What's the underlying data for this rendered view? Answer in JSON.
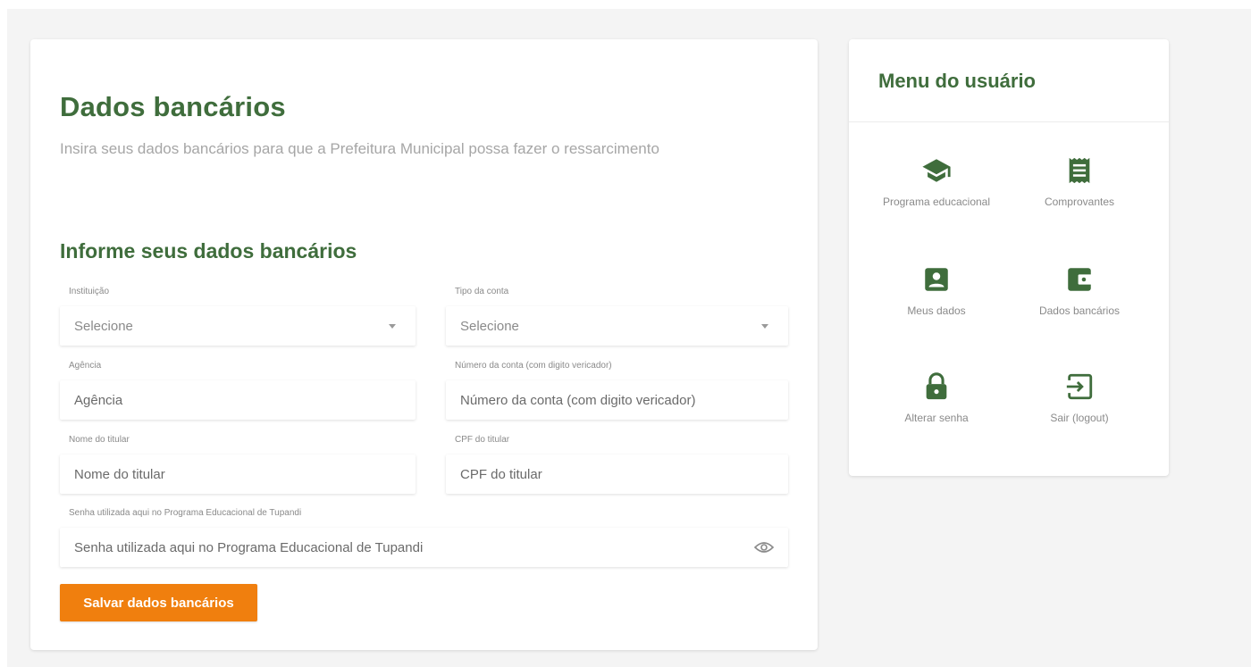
{
  "main": {
    "title": "Dados bancários",
    "subtitle": "Insira seus dados bancários para que a Prefeitura Municipal possa fazer o ressarcimento",
    "section_title": "Informe seus dados bancários",
    "fields": {
      "instituicao": {
        "label": "Instituição",
        "value": "Selecione"
      },
      "tipo_conta": {
        "label": "Tipo da conta",
        "value": "Selecione"
      },
      "agencia": {
        "label": "Agência",
        "placeholder": "Agência"
      },
      "numero_conta": {
        "label": "Número da conta (com digito vericador)",
        "placeholder": "Número da conta (com digito vericador)"
      },
      "nome_titular": {
        "label": "Nome do titular",
        "placeholder": "Nome do titular"
      },
      "cpf_titular": {
        "label": "CPF do titular",
        "placeholder": "CPF do titular"
      },
      "senha": {
        "label": "Senha utilizada aqui no Programa Educacional de Tupandi",
        "placeholder": "Senha utilizada aqui no Programa Educacional de Tupandi"
      }
    },
    "save_label": "Salvar dados bancários"
  },
  "menu": {
    "title": "Menu do usuário",
    "items": [
      {
        "label": "Programa educacional",
        "icon": "graduation-cap-icon"
      },
      {
        "label": "Comprovantes",
        "icon": "receipt-icon"
      },
      {
        "label": "Meus dados",
        "icon": "account-box-icon"
      },
      {
        "label": "Dados bancários",
        "icon": "wallet-icon"
      },
      {
        "label": "Alterar senha",
        "icon": "lock-icon"
      },
      {
        "label": "Sair (logout)",
        "icon": "logout-icon"
      }
    ]
  },
  "colors": {
    "accent_green": "#3f6d3c",
    "button_orange": "#f07f0e",
    "background": "#f4f4f4"
  }
}
